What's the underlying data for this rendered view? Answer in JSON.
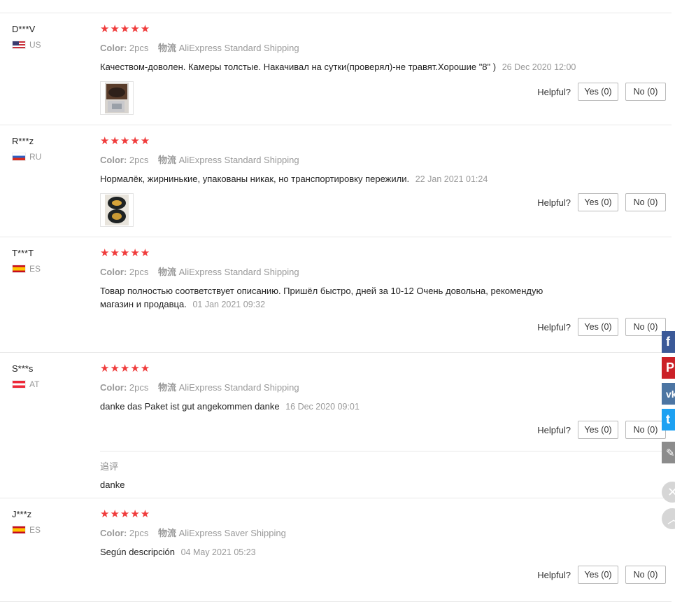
{
  "reviews": [
    {
      "user": "D***V",
      "country": "US",
      "flag": "flag-us",
      "stars": "★★★★★",
      "color_label": "Color:",
      "color_value": "2pcs",
      "logistics_label": "物流",
      "shipping": "AliExpress Standard Shipping",
      "text": "Качеством-доволен. Камеры толстые. Накачивал на сутки(проверял)-не травят.Хорошие \"8\" )",
      "date": "26 Dec 2020 12:00",
      "has_photo": true,
      "helpful_label": "Helpful?",
      "yes": "Yes (0)",
      "no": "No (0)"
    },
    {
      "user": "R***z",
      "country": "RU",
      "flag": "flag-ru",
      "stars": "★★★★★",
      "color_label": "Color:",
      "color_value": "2pcs",
      "logistics_label": "物流",
      "shipping": "AliExpress Standard Shipping",
      "text": "Нормалёк, жирнинькие, упакованы никак, но транспортировку пережили.",
      "date": "22 Jan 2021 01:24",
      "has_photo": true,
      "helpful_label": "Helpful?",
      "yes": "Yes (0)",
      "no": "No (0)"
    },
    {
      "user": "T***T",
      "country": "ES",
      "flag": "flag-es",
      "stars": "★★★★★",
      "color_label": "Color:",
      "color_value": "2pcs",
      "logistics_label": "物流",
      "shipping": "AliExpress Standard Shipping",
      "text_line1": "Товар полностью соответствует описанию. Пришёл быстро, дней за 10-12 Очень довольна, рекомендую",
      "text_line2": "магазин и продавца.",
      "date": "01 Jan 2021 09:32",
      "helpful_label": "Helpful?",
      "yes": "Yes (0)",
      "no": "No (0)"
    },
    {
      "user": "S***s",
      "country": "AT",
      "flag": "flag-at",
      "stars": "★★★★★",
      "color_label": "Color:",
      "color_value": "2pcs",
      "logistics_label": "物流",
      "shipping": "AliExpress Standard Shipping",
      "text": "danke das Paket ist gut angekommen danke",
      "date": "16 Dec 2020 09:01",
      "helpful_label": "Helpful?",
      "yes": "Yes (0)",
      "no": "No (0)",
      "followup_title": "追评",
      "followup_text": "danke"
    },
    {
      "user": "J***z",
      "country": "ES",
      "flag": "flag-es",
      "stars": "★★★★★",
      "color_label": "Color:",
      "color_value": "2pcs",
      "logistics_label": "物流",
      "shipping": "AliExpress Saver Shipping",
      "text": "Según descripción",
      "date": "04 May 2021 05:23",
      "helpful_label": "Helpful?",
      "yes": "Yes (0)",
      "no": "No (0)"
    }
  ],
  "rating": {
    "stars": 5,
    "max": 5
  },
  "share": [
    {
      "name": "facebook",
      "color": "#3b5998",
      "glyph": "f"
    },
    {
      "name": "pinterest",
      "color": "#cb2027",
      "glyph": "P"
    },
    {
      "name": "vk",
      "color": "#4c75a3",
      "glyph": "vk"
    },
    {
      "name": "twitter",
      "color": "#1da1f2",
      "glyph": "t"
    },
    {
      "name": "edit",
      "color": "#8c8c8c",
      "glyph": "✎"
    }
  ]
}
